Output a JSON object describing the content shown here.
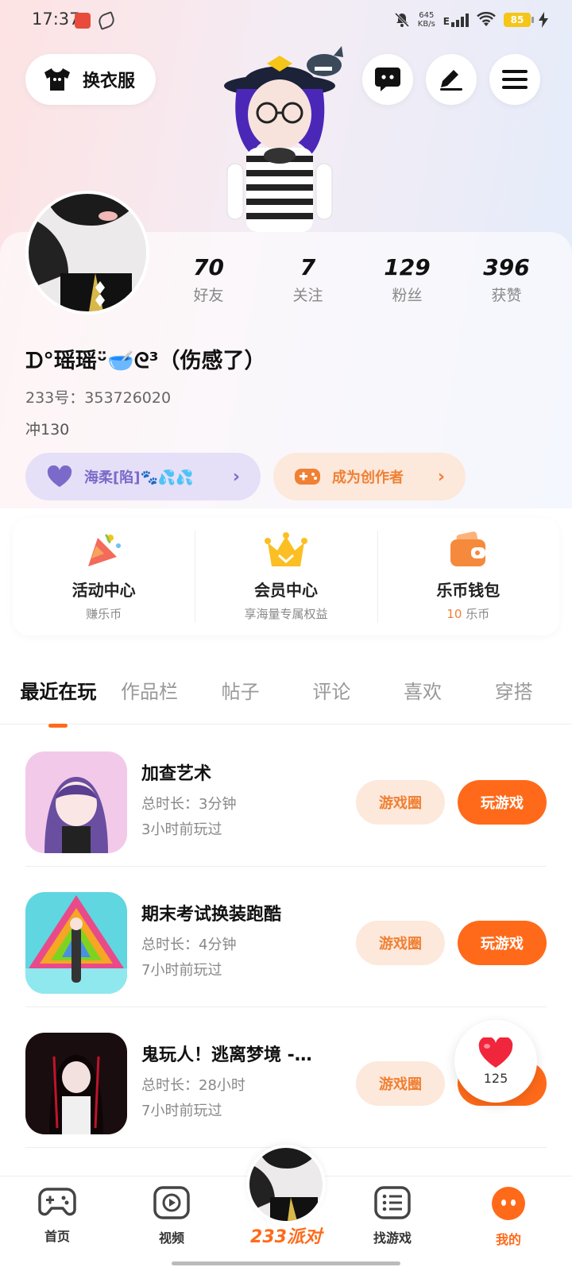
{
  "status": {
    "time": "17:37",
    "net_speed_value": "645",
    "net_speed_unit": "KB/s",
    "network": "E",
    "battery": "85"
  },
  "header": {
    "outfit_label": "换衣服"
  },
  "profile": {
    "stats": [
      {
        "num": "70",
        "label": "好友"
      },
      {
        "num": "7",
        "label": "关注"
      },
      {
        "num": "129",
        "label": "粉丝"
      },
      {
        "num": "396",
        "label": "获赞"
      }
    ],
    "nickname": "ᗪ°瑶瑶ᵕ̈🥣ᘓ³（伤感了）",
    "uid": "233号：353726020",
    "bio": "冲130",
    "guild_label": "海柔[陷]🐾💦💦",
    "creator_label": "成为创作者"
  },
  "features": [
    {
      "title": "活动中心",
      "sub": "赚乐币"
    },
    {
      "title": "会员中心",
      "sub": "享海量专属权益"
    },
    {
      "title": "乐币钱包",
      "sub_count": "10",
      "sub": "乐币"
    }
  ],
  "tabs": [
    "最近在玩",
    "作品栏",
    "帖子",
    "评论",
    "喜欢",
    "穿搭"
  ],
  "games": [
    {
      "name": "加查艺术",
      "duration": "总时长：3分钟",
      "last": "3小时前玩过",
      "circle": "游戏圈",
      "play": "玩游戏"
    },
    {
      "name": "期末考试换装跑酷",
      "duration": "总时长：4分钟",
      "last": "7小时前玩过",
      "circle": "游戏圈",
      "play": "玩游戏"
    },
    {
      "name": "鬼玩人！逃离梦境 -…",
      "duration": "总时长：28小时",
      "last": "7小时前玩过",
      "circle": "游戏圈",
      "play": "玩游戏"
    }
  ],
  "floating": {
    "likes": "125"
  },
  "nav": {
    "home": "首页",
    "video": "视频",
    "center": "233派对",
    "find": "找游戏",
    "mine": "我的"
  },
  "colors": {
    "accent": "#ff6a1a",
    "accent_light": "#fde8dc",
    "guild_bg": "#e6dff8",
    "guild_text": "#7b6ac9"
  }
}
